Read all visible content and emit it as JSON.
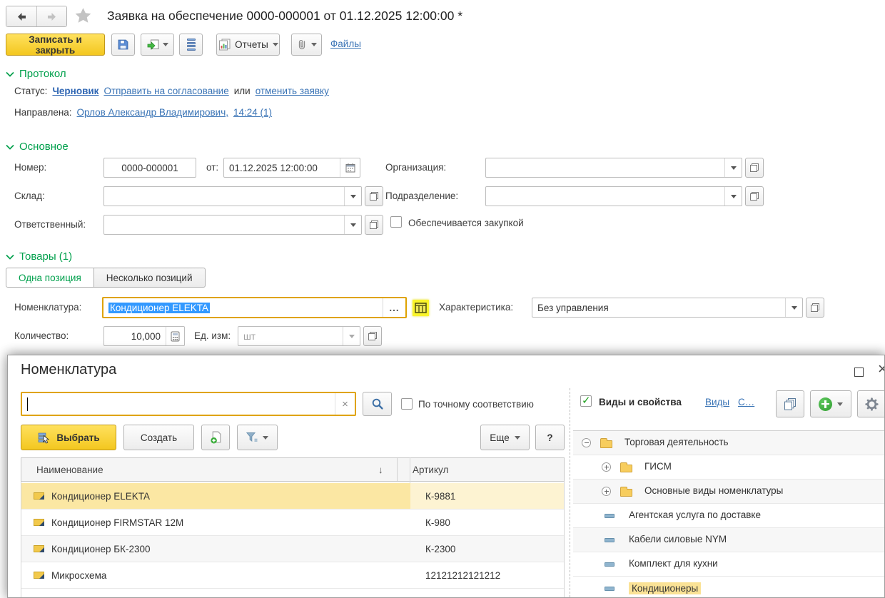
{
  "colors": {
    "accent_green": "#00A04C",
    "link_blue": "#3973B5",
    "button_yellow": "#F3C71F",
    "focus_border": "#DFA300",
    "selection_row_yellow": "#FBE7A3",
    "text_selection_blue": "#3399FF"
  },
  "icons": {
    "sort_desc": "↓",
    "close": "×",
    "clear": "×",
    "ellipsis": "..."
  },
  "header": {
    "title": "Заявка на обеспечение 0000-000001 от 01.12.2025 12:00:00 *"
  },
  "toolbar": {
    "save_close": "Записать и закрыть",
    "reports": "Отчеты",
    "files": "Файлы"
  },
  "protocol": {
    "header": "Протокол",
    "status_label": "Статус:",
    "status_value": "Черновик",
    "send_link": "Отправить на согласование",
    "or": "или",
    "cancel_link": "отменить заявку",
    "sent_label": "Направлена:",
    "sent_person": "Орлов Александр Владимирович,",
    "sent_time": "14:24 (1)"
  },
  "general": {
    "header": "Основное",
    "number_label": "Номер:",
    "number_value": "0000-000001",
    "date_label": "от:",
    "date_value": "01.12.2025 12:00:00",
    "organization_label": "Организация:",
    "warehouse_label": "Склад:",
    "department_label": "Подразделение:",
    "responsible_label": "Ответственный:",
    "purchase_checkbox": "Обеспечивается закупкой"
  },
  "goods": {
    "header": "Товары (1)",
    "tabs": [
      "Одна позиция",
      "Несколько позиций"
    ],
    "nomenclature_label": "Номенклатура:",
    "nomenclature_value": "Кондиционер ELEKTA",
    "characteristic_label": "Характеристика:",
    "characteristic_value": "Без управления",
    "quantity_label": "Количество:",
    "quantity_value": "10,000",
    "unit_label": "Ед. изм:",
    "unit_value": "шт"
  },
  "picker": {
    "title": "Номенклатура",
    "exact_match": "По точному соответствию",
    "select_btn": "Выбрать",
    "create_btn": "Создать",
    "more_btn": "Еще",
    "help_btn": "?",
    "columns": [
      "Наименование",
      "Артикул"
    ],
    "rows": [
      {
        "name": "Кондиционер ELEKTA",
        "sku": "К-9881"
      },
      {
        "name": "Кондиционер FIRMSTAR 12М",
        "sku": "К-980"
      },
      {
        "name": "Кондиционер БК-2300",
        "sku": "К-2300"
      },
      {
        "name": "Микросхема",
        "sku": "12121212121212"
      }
    ],
    "types_panel": {
      "checkbox_label": "Виды и свойства",
      "link_types": "Виды",
      "link_more": "С…",
      "tree": [
        {
          "label": "Торговая деятельность"
        },
        {
          "label": "ГИСМ"
        },
        {
          "label": "Основные виды номенклатуры"
        },
        {
          "label": "Агентская услуга по доставке"
        },
        {
          "label": "Кабели силовые NYM"
        },
        {
          "label": "Комплект для кухни"
        },
        {
          "label": "Кондиционеры"
        }
      ]
    }
  }
}
